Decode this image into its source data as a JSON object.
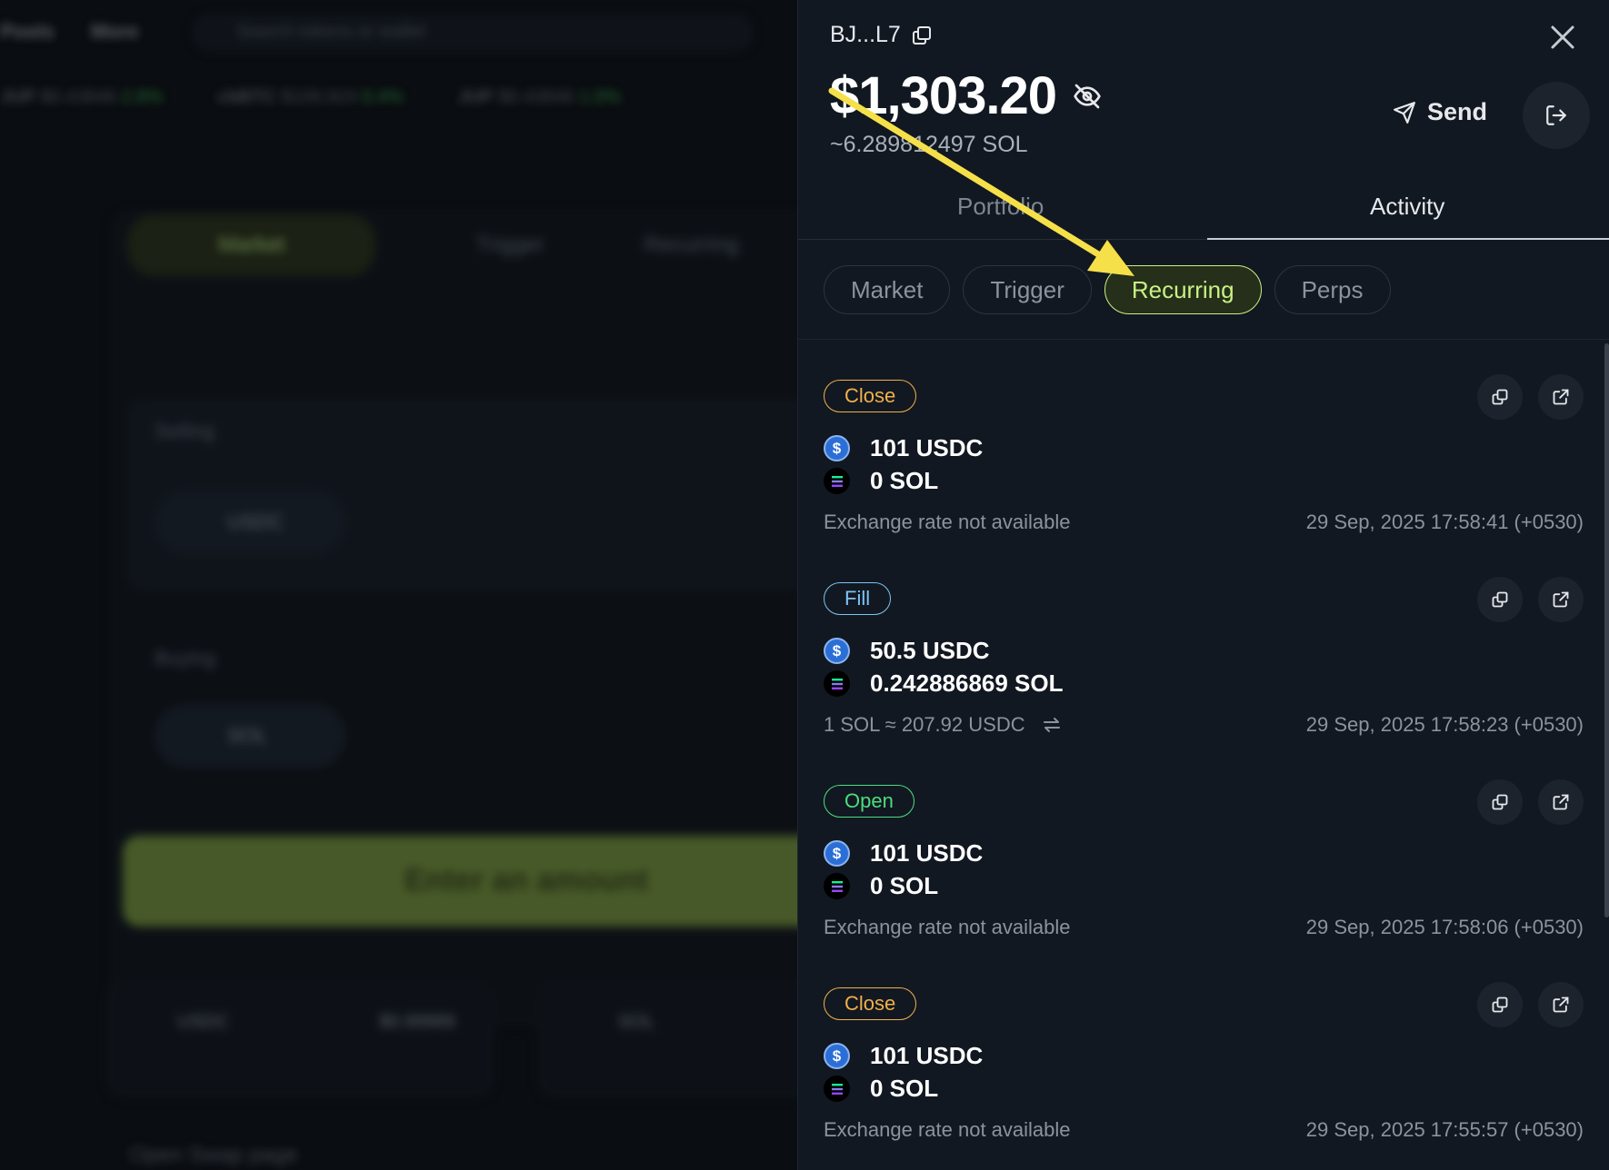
{
  "backdrop": {
    "nav": [
      "Pools",
      "More"
    ],
    "search_placeholder": "Search tokens or wallet",
    "ticker": [
      {
        "sym": "JUP",
        "price": "$0.43846",
        "pct": "2.8%"
      },
      {
        "sym": "cbBTC",
        "price": "$109,924",
        "pct": "0.4%"
      },
      {
        "sym": "JUP",
        "price": "$0.43846",
        "pct": "1.0%"
      }
    ],
    "tabs": [
      "Market",
      "Trigger",
      "Recurring"
    ],
    "selling_label": "Selling",
    "buying_label": "Buying",
    "sell_token": "USDC",
    "buy_token": "SOL",
    "cta": "Enter an amount",
    "bottom_token_1": "USDC",
    "bottom_price_1": "$0.99989",
    "bottom_token_2": "SOL",
    "footer": "Open Swap page"
  },
  "wallet": {
    "address": "BJ...L7",
    "balance": "$1,303.20",
    "sol_balance": "~6.289812497 SOL",
    "send_label": "Send"
  },
  "main_tabs": [
    {
      "label": "Portfolio",
      "active": false
    },
    {
      "label": "Activity",
      "active": true
    }
  ],
  "sub_tabs": [
    {
      "label": "Market",
      "active": false
    },
    {
      "label": "Trigger",
      "active": false
    },
    {
      "label": "Recurring",
      "active": true
    },
    {
      "label": "Perps",
      "active": false
    }
  ],
  "activity": [
    {
      "badge": "Close",
      "kind": "close",
      "from": "101 USDC",
      "to": "0 SOL",
      "rate": "Exchange rate not available",
      "has_swap_icon": false,
      "time": "29 Sep, 2025 17:58:41 (+0530)"
    },
    {
      "badge": "Fill",
      "kind": "fill",
      "from": "50.5 USDC",
      "to": "0.242886869 SOL",
      "rate": "1 SOL ≈ 207.92 USDC",
      "has_swap_icon": true,
      "time": "29 Sep, 2025 17:58:23 (+0530)"
    },
    {
      "badge": "Open",
      "kind": "open",
      "from": "101 USDC",
      "to": "0 SOL",
      "rate": "Exchange rate not available",
      "has_swap_icon": false,
      "time": "29 Sep, 2025 17:58:06 (+0530)"
    },
    {
      "badge": "Close",
      "kind": "close",
      "from": "101 USDC",
      "to": "0 SOL",
      "rate": "Exchange rate not available",
      "has_swap_icon": false,
      "time": "29 Sep, 2025 17:55:57 (+0530)"
    }
  ],
  "icons": {
    "usdc": "usdc-token-icon",
    "sol": "sol-token-icon",
    "copy": "copy-icon",
    "external": "external-link-icon",
    "eye_off": "eye-off-icon",
    "send": "send-icon",
    "logout": "logout-icon",
    "close": "close-icon",
    "swap": "swap-arrows-icon"
  },
  "colors": {
    "accent": "#c7f284",
    "annotation_arrow": "#f5e04a",
    "badge_close": "#f0b04a",
    "badge_fill": "#7cc4f5",
    "badge_open": "#4ade80"
  }
}
